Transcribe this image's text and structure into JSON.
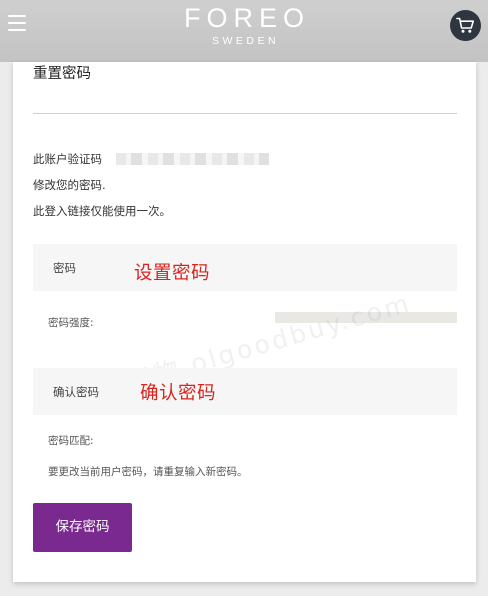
{
  "header": {
    "brand_name": "FOREO",
    "brand_sub": "SWEDEN",
    "menu_icon": "hamburger-icon",
    "cart_icon": "cart-icon"
  },
  "form": {
    "title": "重置密码",
    "account_line": "此账户验证码",
    "instruction_line1": "修改您的密码.",
    "instruction_line2": "此登入链接仅能使用一次。",
    "password_label": "密码",
    "password_annotation": "设置密码",
    "strength_label": "密码强度:",
    "confirm_label": "确认密码",
    "confirm_annotation": "确认密码",
    "match_label": "密码匹配:",
    "hint": "要更改当前用户密码，请重复输入新密码。",
    "save_label": "保存密码"
  },
  "watermark": "乐享好物 olgoodbuy.com",
  "colors": {
    "header_bg": "#c8c8c8",
    "cart_bg": "#2f3640",
    "button_bg": "#7a2a8f",
    "annotation": "#d8261f",
    "field_bg": "#f6f6f6"
  }
}
